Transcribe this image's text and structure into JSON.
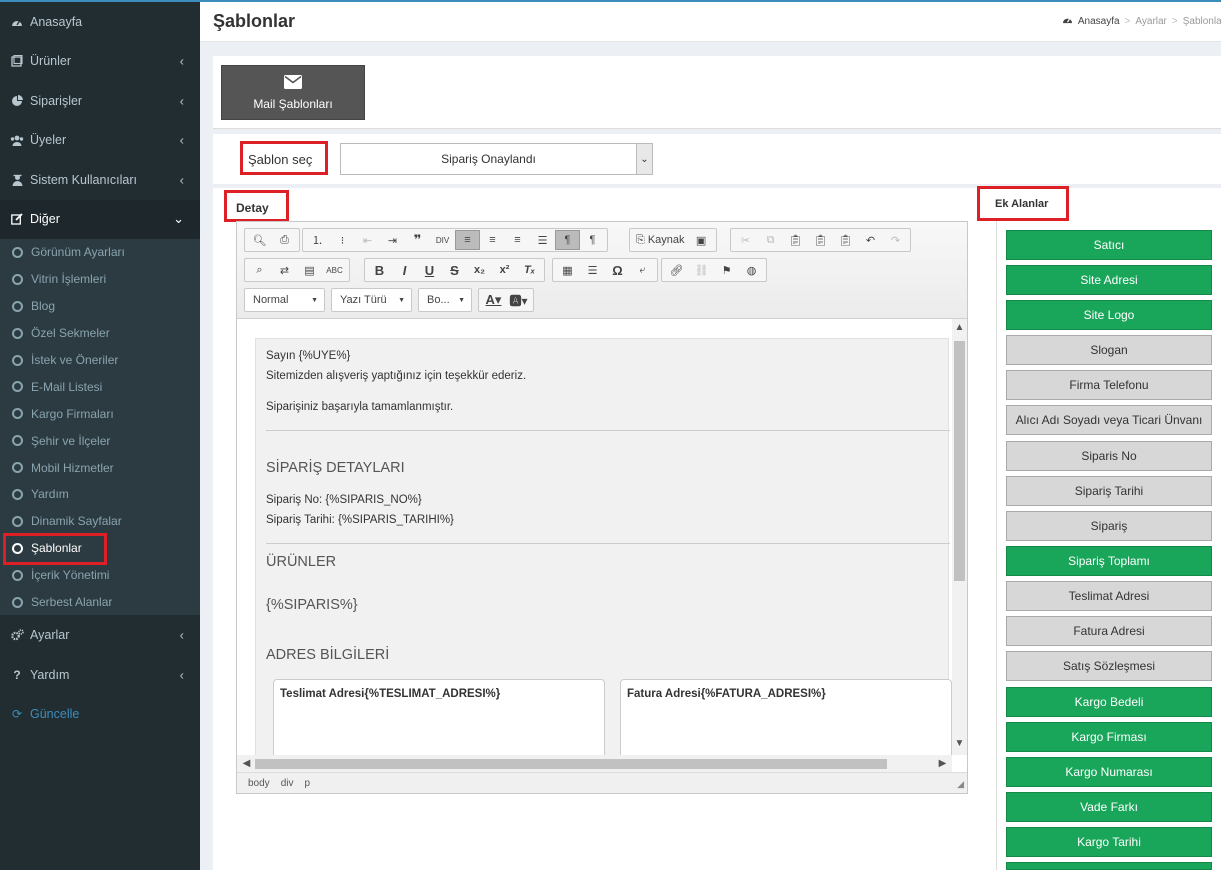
{
  "header": {
    "page_title": "Şablonlar",
    "breadcrumb": [
      "Anasayfa",
      "Ayarlar",
      "Şablonlar"
    ]
  },
  "sidebar": {
    "items": [
      {
        "label": "Anasayfa",
        "icon": "dashboard-icon",
        "chevron": false
      },
      {
        "label": "Ürünler",
        "icon": "products-icon",
        "chevron": true
      },
      {
        "label": "Siparişler",
        "icon": "pie-chart-icon",
        "chevron": true
      },
      {
        "label": "Üyeler",
        "icon": "users-icon",
        "chevron": true
      },
      {
        "label": "Sistem Kullanıcıları",
        "icon": "user-secret-icon",
        "chevron": true
      },
      {
        "label": "Diğer",
        "icon": "edit-icon",
        "chevron": true
      }
    ],
    "submenu": [
      "Görünüm Ayarları",
      "Vitrin İşlemleri",
      "Blog",
      "Özel Sekmeler",
      "İstek ve Öneriler",
      "E-Mail Listesi",
      "Kargo Firmaları",
      "Şehir ve İlçeler",
      "Mobil Hizmetler",
      "Yardım",
      "Dinamik Sayfalar",
      "Şablonlar",
      "İçerik Yönetimi",
      "Serbest Alanlar"
    ],
    "bottom": [
      {
        "label": "Ayarlar",
        "icon": "cogs-icon",
        "chevron": true
      },
      {
        "label": "Yardım",
        "icon": "question-icon",
        "chevron": true
      },
      {
        "label": "Güncelle",
        "icon": "refresh-icon",
        "chevron": false
      }
    ]
  },
  "mail_tab": {
    "label": "Mail Şablonları",
    "icon": "envelope-icon"
  },
  "template_select": {
    "label": "Şablon seç",
    "selected": "Sipariş Onaylandı"
  },
  "sections": {
    "detail": "Detay",
    "extra_fields": "Ek Alanlar"
  },
  "toolbar": {
    "source_label": "Kaynak",
    "format_combo": "Normal",
    "font_combo": "Yazı Türü",
    "size_combo": "Bo..."
  },
  "document": {
    "greeting": "Sayın {%UYE%}",
    "thanks": "Sitemizden alışveriş yaptığınız için teşekkür ederiz.",
    "completed": "Siparişiniz başarıyla tamamlanmıştır.",
    "order_details_heading": "SİPARİŞ DETAYLARI",
    "order_no": "Sipariş No:  {%SIPARIS_NO%}",
    "order_date": "Sipariş Tarihi: {%SIPARIS_TARIHI%}",
    "products_heading": "ÜRÜNLER",
    "order_placeholder": "{%SIPARIS%}",
    "address_heading": "ADRES BİLGİLERİ",
    "delivery_address": "Teslimat Adresi{%TESLIMAT_ADRESI%}",
    "invoice_address": "Fatura Adresi{%FATURA_ADRESI%}"
  },
  "statusbar": [
    "body",
    "div",
    "p"
  ],
  "fields": [
    {
      "label": "Satıcı",
      "state": "green"
    },
    {
      "label": "Site Adresi",
      "state": "green"
    },
    {
      "label": "Site Logo",
      "state": "green"
    },
    {
      "label": "Slogan",
      "state": "gray"
    },
    {
      "label": "Firma Telefonu",
      "state": "gray"
    },
    {
      "label": "Alıcı Adı Soyadı veya Ticari Ünvanı",
      "state": "gray"
    },
    {
      "label": "Siparis No",
      "state": "gray"
    },
    {
      "label": "Sipariş Tarihi",
      "state": "gray"
    },
    {
      "label": "Sipariş",
      "state": "gray"
    },
    {
      "label": "Sipariş Toplamı",
      "state": "green"
    },
    {
      "label": "Teslimat Adresi",
      "state": "gray"
    },
    {
      "label": "Fatura Adresi",
      "state": "gray"
    },
    {
      "label": "Satış Sözleşmesi",
      "state": "gray"
    },
    {
      "label": "Kargo Bedeli",
      "state": "green"
    },
    {
      "label": "Kargo Firması",
      "state": "green"
    },
    {
      "label": "Kargo Numarası",
      "state": "green"
    },
    {
      "label": "Vade Farkı",
      "state": "green"
    },
    {
      "label": "Kargo Tarihi",
      "state": "green"
    }
  ],
  "colors": {
    "sidebar_bg": "#222d32",
    "highlight_red": "#dd1f26",
    "field_green": "#1aa65a",
    "field_gray": "#d7d7d7",
    "accent_blue": "#3c8dbc"
  }
}
